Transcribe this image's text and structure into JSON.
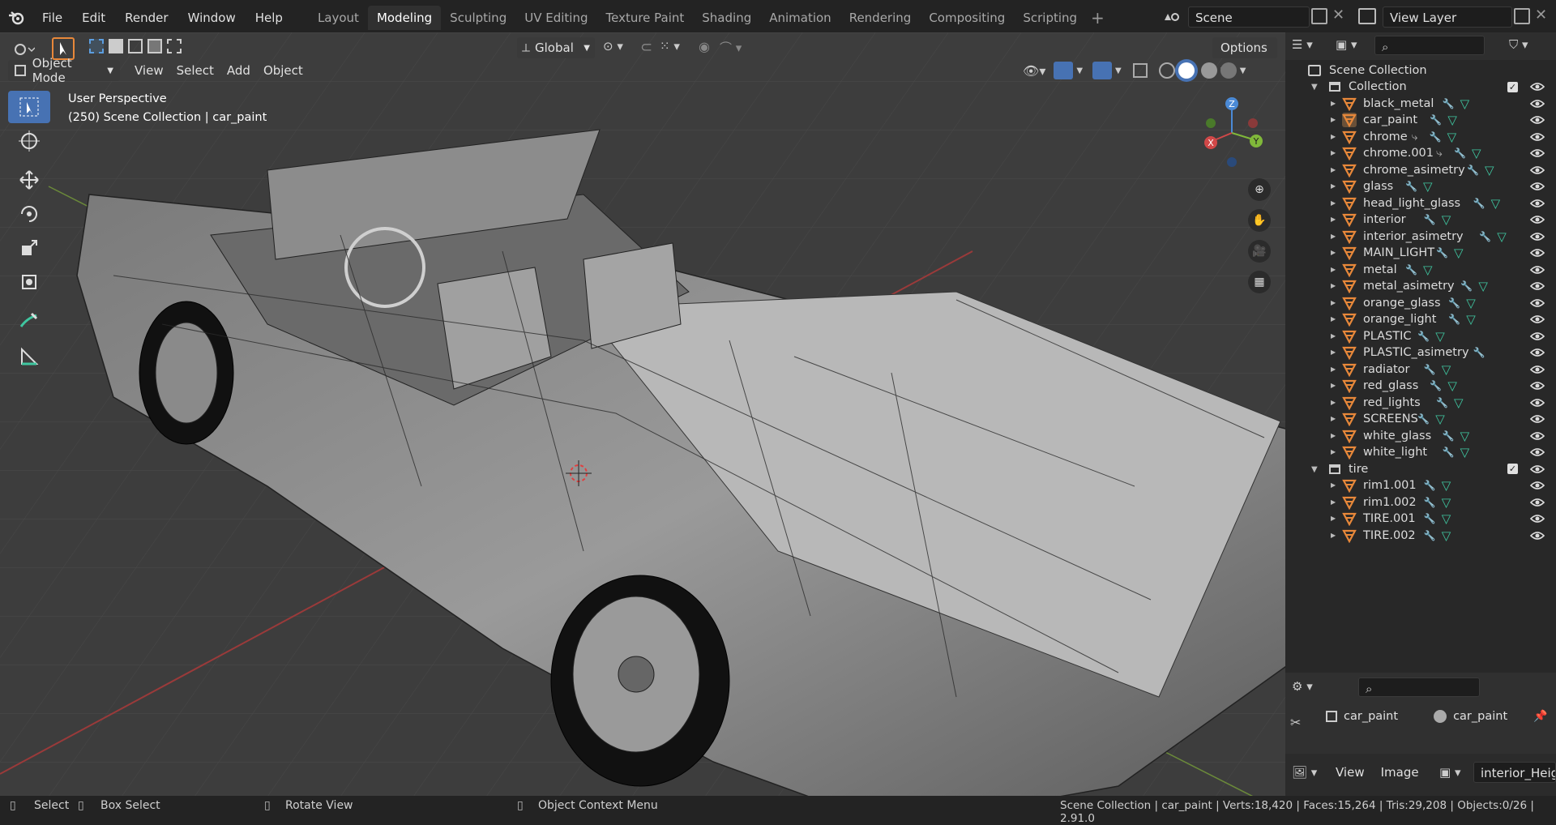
{
  "menus": [
    "File",
    "Edit",
    "Render",
    "Window",
    "Help"
  ],
  "workspaces": [
    "Layout",
    "Modeling",
    "Sculpting",
    "UV Editing",
    "Texture Paint",
    "Shading",
    "Animation",
    "Rendering",
    "Compositing",
    "Scripting"
  ],
  "active_workspace": "Modeling",
  "scene_name": "Scene",
  "view_layer": "View Layer",
  "viewport": {
    "mode": "Object Mode",
    "menus": [
      "View",
      "Select",
      "Add",
      "Object"
    ],
    "orientation": "Global",
    "options_label": "Options",
    "overlay_title": "User Perspective",
    "overlay_subtitle": "(250) Scene Collection | car_paint",
    "gizmo": {
      "x": "X",
      "y": "Y",
      "z": "Z"
    }
  },
  "outliner": {
    "root": "Scene Collection",
    "collections": [
      {
        "name": "Collection",
        "objects": [
          {
            "name": "black_metal",
            "mods": [
              "modifier",
              "mesh"
            ]
          },
          {
            "name": "car_paint",
            "mods": [
              "modifier",
              "mesh"
            ],
            "selected": true
          },
          {
            "name": "chrome",
            "mods": [
              "constraint",
              "modifier",
              "mesh"
            ]
          },
          {
            "name": "chrome.001",
            "mods": [
              "constraint",
              "modifier",
              "mesh"
            ]
          },
          {
            "name": "chrome_asimetry",
            "mods": [
              "modifier",
              "mesh"
            ]
          },
          {
            "name": "glass",
            "mods": [
              "modifier",
              "mesh"
            ]
          },
          {
            "name": "head_light_glass",
            "mods": [
              "modifier",
              "mesh"
            ]
          },
          {
            "name": "interior",
            "mods": [
              "modifier",
              "mesh"
            ]
          },
          {
            "name": "interior_asimetry",
            "mods": [
              "modifier",
              "mesh"
            ]
          },
          {
            "name": "MAIN_LIGHT",
            "mods": [
              "modifier",
              "mesh"
            ]
          },
          {
            "name": "metal",
            "mods": [
              "modifier",
              "mesh"
            ]
          },
          {
            "name": "metal_asimetry",
            "mods": [
              "modifier",
              "mesh"
            ]
          },
          {
            "name": "orange_glass",
            "mods": [
              "modifier",
              "mesh"
            ]
          },
          {
            "name": "orange_light",
            "mods": [
              "modifier",
              "mesh"
            ]
          },
          {
            "name": "PLASTIC",
            "mods": [
              "modifier",
              "mesh"
            ]
          },
          {
            "name": "PLASTIC_asimetry",
            "mods": [
              "modifier"
            ]
          },
          {
            "name": "radiator",
            "mods": [
              "modifier",
              "mesh"
            ]
          },
          {
            "name": "red_glass",
            "mods": [
              "modifier",
              "mesh"
            ]
          },
          {
            "name": "red_lights",
            "mods": [
              "modifier",
              "mesh"
            ]
          },
          {
            "name": "SCREENS",
            "mods": [
              "modifier",
              "mesh"
            ]
          },
          {
            "name": "white_glass",
            "mods": [
              "modifier",
              "mesh"
            ]
          },
          {
            "name": "white_light",
            "mods": [
              "modifier",
              "mesh"
            ]
          }
        ]
      },
      {
        "name": "tire",
        "objects": [
          {
            "name": "rim1.001",
            "mods": [
              "modifier",
              "mesh"
            ]
          },
          {
            "name": "rim1.002",
            "mods": [
              "modifier",
              "mesh"
            ]
          },
          {
            "name": "TIRE.001",
            "mods": [
              "modifier",
              "mesh"
            ]
          },
          {
            "name": "TIRE.002",
            "mods": [
              "modifier",
              "mesh"
            ]
          }
        ]
      }
    ]
  },
  "properties": {
    "object": "car_paint",
    "material": "car_paint"
  },
  "image_editor": {
    "menus": [
      "View",
      "Image"
    ],
    "image_name": "interior_Height.p"
  },
  "statusbar": {
    "select": "Select",
    "box_select": "Box Select",
    "rotate": "Rotate View",
    "context": "Object Context Menu",
    "info": "Scene Collection | car_paint | Verts:18,420 | Faces:15,264 | Tris:29,208 | Objects:0/26 | 2.91.0"
  },
  "colors": {
    "accent": "#4772b3",
    "mesh_orange": "#e8883a",
    "modifier_blue": "#5c9ee0",
    "mesh_green": "#3fc6a0"
  }
}
